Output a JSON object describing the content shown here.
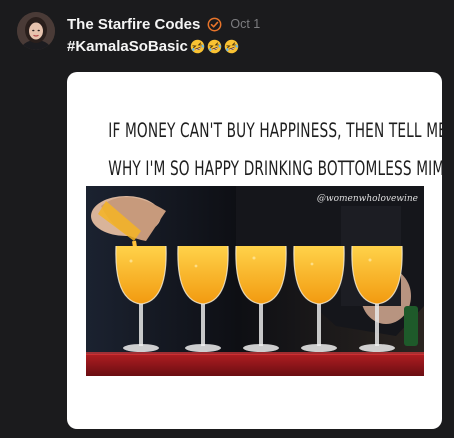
{
  "post": {
    "author": "The Starfire Codes",
    "date": "Oct 1",
    "hashtag": "#KamalaSoBasic",
    "emojis": [
      "rolling-on-floor-laughing",
      "rolling-on-floor-laughing",
      "rolling-on-floor-laughing"
    ],
    "verified_icon": "check-circle-icon",
    "colors": {
      "background": "#1b1b1d",
      "verified": "#e8742a",
      "date": "#7d7d80"
    }
  },
  "media": {
    "meme_line_1": "IF MONEY CAN'T BUY HAPPINESS, THEN TELL ME",
    "meme_line_2": "WHY I'M SO HAPPY DRINKING BOTTOMLESS MIMOSAS",
    "watermark": "@womenwholovewine"
  }
}
